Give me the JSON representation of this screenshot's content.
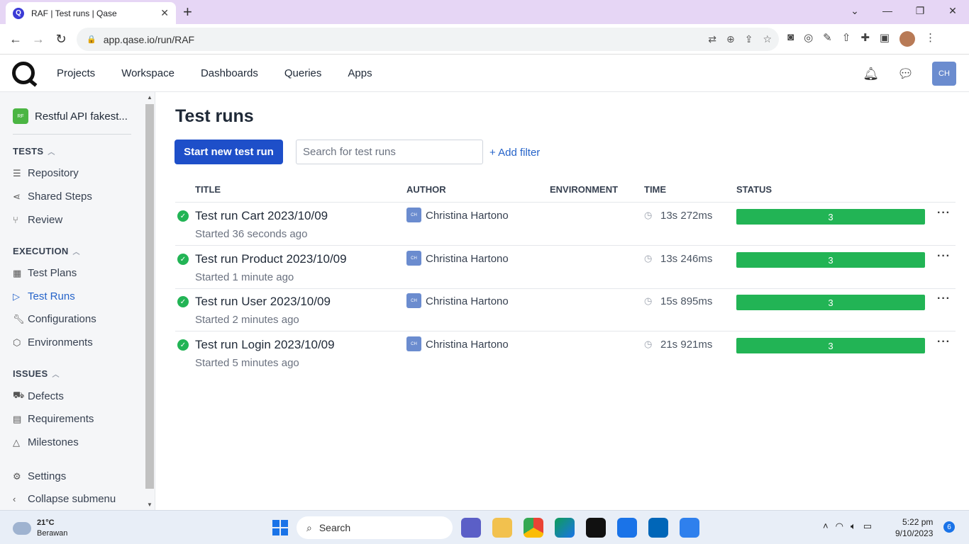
{
  "browser": {
    "tab_title": "RAF | Test runs | Qase",
    "favicon_letter": "Q",
    "url": "app.qase.io/run/RAF"
  },
  "topnav": {
    "items": [
      "Projects",
      "Workspace",
      "Dashboards",
      "Queries",
      "Apps"
    ],
    "user_initials": "CH"
  },
  "sidebar": {
    "project_badge": "RF",
    "project_name": "Restful API fakest...",
    "sections": {
      "tests": {
        "title": "TESTS",
        "items": [
          "Repository",
          "Shared Steps",
          "Review"
        ]
      },
      "execution": {
        "title": "EXECUTION",
        "items": [
          "Test Plans",
          "Test Runs",
          "Configurations",
          "Environments"
        ]
      },
      "issues": {
        "title": "ISSUES",
        "items": [
          "Defects",
          "Requirements",
          "Milestones"
        ]
      }
    },
    "settings": "Settings",
    "collapse": "Collapse submenu"
  },
  "main": {
    "title": "Test runs",
    "start_button": "Start new test run",
    "search_placeholder": "Search for test runs",
    "add_filter": "+ Add filter",
    "columns": [
      "TITLE",
      "AUTHOR",
      "ENVIRONMENT",
      "TIME",
      "STATUS"
    ],
    "runs": [
      {
        "title": "Test run Cart 2023/10/09",
        "started": "Started 36 seconds ago",
        "author_initials": "CH",
        "author": "Christina Hartono",
        "time": "13s 272ms",
        "status_count": "3"
      },
      {
        "title": "Test run Product 2023/10/09",
        "started": "Started 1 minute ago",
        "author_initials": "CH",
        "author": "Christina Hartono",
        "time": "13s 246ms",
        "status_count": "3"
      },
      {
        "title": "Test run User 2023/10/09",
        "started": "Started 2 minutes ago",
        "author_initials": "CH",
        "author": "Christina Hartono",
        "time": "15s 895ms",
        "status_count": "3"
      },
      {
        "title": "Test run Login 2023/10/09",
        "started": "Started 5 minutes ago",
        "author_initials": "CH",
        "author": "Christina Hartono",
        "time": "21s 921ms",
        "status_count": "3"
      }
    ]
  },
  "taskbar": {
    "temp": "21°C",
    "weather": "Berawan",
    "search": "Search",
    "time": "5:22 pm",
    "date": "9/10/2023",
    "notifications": "6"
  },
  "colors": {
    "primary": "#1e4fc9",
    "success": "#22b455",
    "link": "#2563c9",
    "tab_bar": "#e6d6f5"
  }
}
